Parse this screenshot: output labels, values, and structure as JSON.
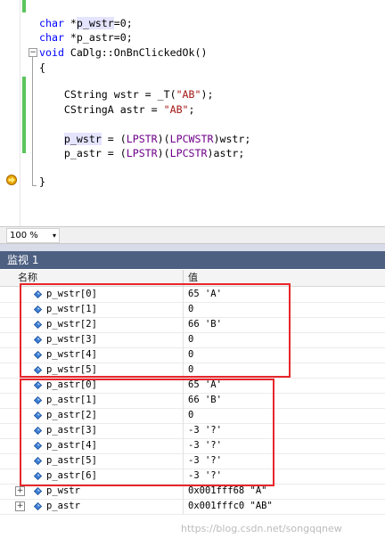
{
  "editor": {
    "lines": [
      {
        "html": "<span class=\"kw\">char</span> *<span class=\"hl\">p_wstr</span>=0;"
      },
      {
        "html": "<span class=\"kw\">char</span> *p_astr=0;"
      },
      {
        "html": "<span class=\"kw\">void</span> CaDlg::OnBnClickedOk()"
      },
      {
        "html": "{"
      },
      {
        "html": ""
      },
      {
        "html": "    CString wstr = _T(<span class=\"str\">\"AB\"</span>);"
      },
      {
        "html": "    CStringA astr = <span class=\"str\">\"AB\"</span>;"
      },
      {
        "html": ""
      },
      {
        "html": "    <span class=\"hl\">p_wstr</span> = (<span class=\"mac\">LPSTR</span>)(<span class=\"mac\">LPCWSTR</span>)wstr;"
      },
      {
        "html": "    p_astr = (<span class=\"mac\">LPSTR</span>)(<span class=\"mac\">LPCSTR</span>)astr;"
      },
      {
        "html": ""
      },
      {
        "html": "}"
      }
    ],
    "zoom": "100 %",
    "zoom_arrow": "▾"
  },
  "watch": {
    "title": "监视 1",
    "col_name": "名称",
    "col_value": "值",
    "rows": [
      {
        "name": "p_wstr[0]",
        "value": "65 'A'"
      },
      {
        "name": "p_wstr[1]",
        "value": "0"
      },
      {
        "name": "p_wstr[2]",
        "value": "66 'B'"
      },
      {
        "name": "p_wstr[3]",
        "value": "0"
      },
      {
        "name": "p_wstr[4]",
        "value": "0"
      },
      {
        "name": "p_wstr[5]",
        "value": "0"
      },
      {
        "name": "p_astr[0]",
        "value": "65 'A'"
      },
      {
        "name": "p_astr[1]",
        "value": "66 'B'"
      },
      {
        "name": "p_astr[2]",
        "value": "0"
      },
      {
        "name": "p_astr[3]",
        "value": "-3 '?'"
      },
      {
        "name": "p_astr[4]",
        "value": "-3 '?'"
      },
      {
        "name": "p_astr[5]",
        "value": "-3 '?'"
      },
      {
        "name": "p_astr[6]",
        "value": "-3 '?'"
      },
      {
        "name": "p_wstr",
        "value": "0x001fff68 \"A\"",
        "expandable": true,
        "expander": "+"
      },
      {
        "name": "p_astr",
        "value": "0x001fffc0 \"AB\"",
        "expandable": true,
        "expander": "+"
      }
    ]
  },
  "watermark": "https://blog.csdn.net/songqqnew",
  "colors": {
    "keyword": "#0000ff",
    "string": "#a31515",
    "macro": "#6f008a",
    "change_bar": "#5cc55c",
    "title_bar": "#4d6082",
    "highlight_box": "#e8262a"
  }
}
